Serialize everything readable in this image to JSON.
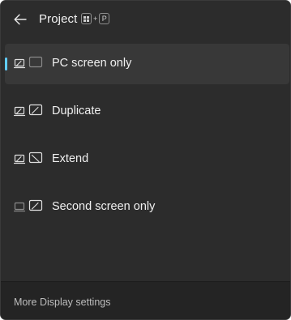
{
  "header": {
    "title": "Project",
    "back_icon": "back-arrow-icon",
    "shortcut": {
      "win_icon": "windows-logo-icon",
      "plus": "+",
      "key": "P"
    }
  },
  "options": [
    {
      "label": "PC screen only",
      "icon": "pc-screen-only-icon",
      "selected": true
    },
    {
      "label": "Duplicate",
      "icon": "duplicate-icon",
      "selected": false
    },
    {
      "label": "Extend",
      "icon": "extend-icon",
      "selected": false
    },
    {
      "label": "Second screen only",
      "icon": "second-screen-only-icon",
      "selected": false
    }
  ],
  "footer": {
    "link_label": "More Display settings"
  },
  "colors": {
    "accent": "#60cdff",
    "panel_bg": "#2c2c2c",
    "selected_bg": "#383838",
    "footer_bg": "#242424",
    "text": "#f0f0f0"
  }
}
